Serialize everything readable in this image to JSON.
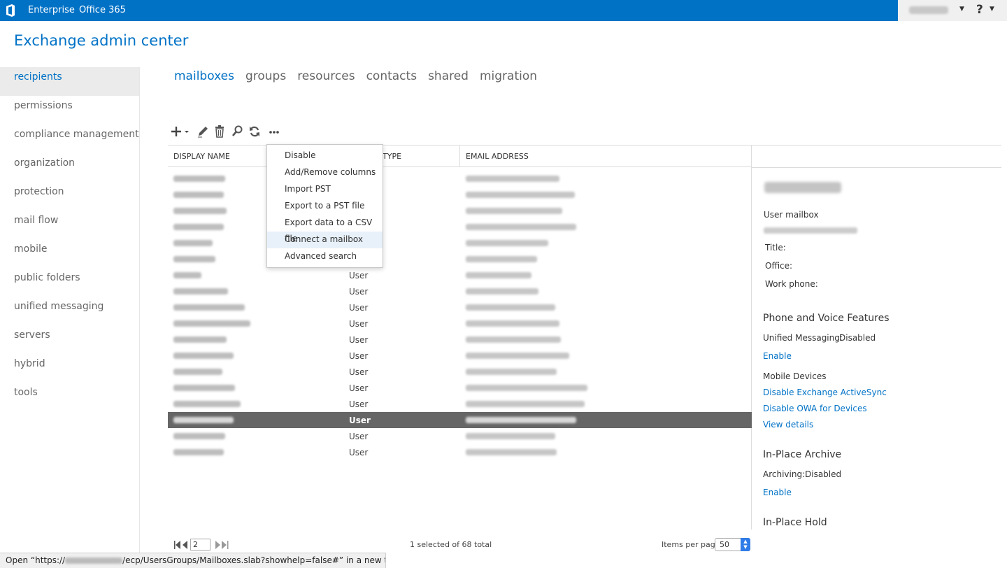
{
  "topbar": {
    "brand_color": "#0072c6",
    "links": [
      "Enterprise",
      "Office 365"
    ],
    "icons": [
      "office-logo-icon",
      "chevron-down-icon",
      "help-icon"
    ],
    "help_label": "?"
  },
  "header": {
    "title": "Exchange admin center"
  },
  "leftnav": {
    "items": [
      {
        "label": "recipients",
        "active": true
      },
      {
        "label": "permissions"
      },
      {
        "label": "compliance management"
      },
      {
        "label": "organization"
      },
      {
        "label": "protection"
      },
      {
        "label": "mail flow"
      },
      {
        "label": "mobile"
      },
      {
        "label": "public folders"
      },
      {
        "label": "unified messaging"
      },
      {
        "label": "servers"
      },
      {
        "label": "hybrid"
      },
      {
        "label": "tools"
      }
    ]
  },
  "tabs": [
    {
      "label": "mailboxes",
      "active": true
    },
    {
      "label": "groups"
    },
    {
      "label": "resources"
    },
    {
      "label": "contacts"
    },
    {
      "label": "shared"
    },
    {
      "label": "migration"
    }
  ],
  "toolbar": {
    "icons": [
      "add-icon",
      "edit-icon",
      "delete-icon",
      "search-icon",
      "refresh-icon",
      "more-icon"
    ]
  },
  "grid": {
    "columns": [
      "DISPLAY NAME",
      "TYPE",
      "EMAIL ADDRESS"
    ],
    "rows": [
      {
        "type": ""
      },
      {
        "type": ""
      },
      {
        "type": ""
      },
      {
        "type": ""
      },
      {
        "type": ""
      },
      {
        "type": ""
      },
      {
        "type": "User"
      },
      {
        "type": "User"
      },
      {
        "type": "User"
      },
      {
        "type": "User"
      },
      {
        "type": "User"
      },
      {
        "type": "User"
      },
      {
        "type": "User"
      },
      {
        "type": "User"
      },
      {
        "type": "User"
      },
      {
        "type": "User",
        "selected": true
      },
      {
        "type": "User"
      },
      {
        "type": "User"
      }
    ]
  },
  "menu": {
    "items": [
      "Disable",
      "Add/Remove columns",
      "Import PST",
      "Export to a PST file",
      "Export data to a CSV file",
      "Connect a mailbox",
      "Advanced search"
    ],
    "highlighted": "Connect a mailbox"
  },
  "details": {
    "mailbox_type": "User mailbox",
    "title_label": "Title:",
    "office_label": "Office:",
    "work_phone_label": "Work phone:",
    "phone_voice_heading": "Phone and Voice Features",
    "um_label": "Unified Messaging:",
    "um_value": "Disabled",
    "um_enable": "Enable",
    "mobile_heading": "Mobile Devices",
    "disable_eas": "Disable Exchange ActiveSync",
    "disable_owa": "Disable OWA for Devices",
    "view_details": "View details",
    "archive_heading": "In-Place Archive",
    "archiving_label": "Archiving:",
    "archiving_value": "Disabled",
    "archive_enable": "Enable",
    "hold_heading": "In-Place Hold"
  },
  "pager": {
    "page": "2",
    "status": "1 selected of 68 total",
    "items_per_page_label": "Items per page",
    "items_per_page": "50"
  },
  "statusbar": {
    "prefix": "Open “https://",
    "suffix": "/ecp/UsersGroups/Mailboxes.slab?showhelp=false#” in a new tab"
  }
}
